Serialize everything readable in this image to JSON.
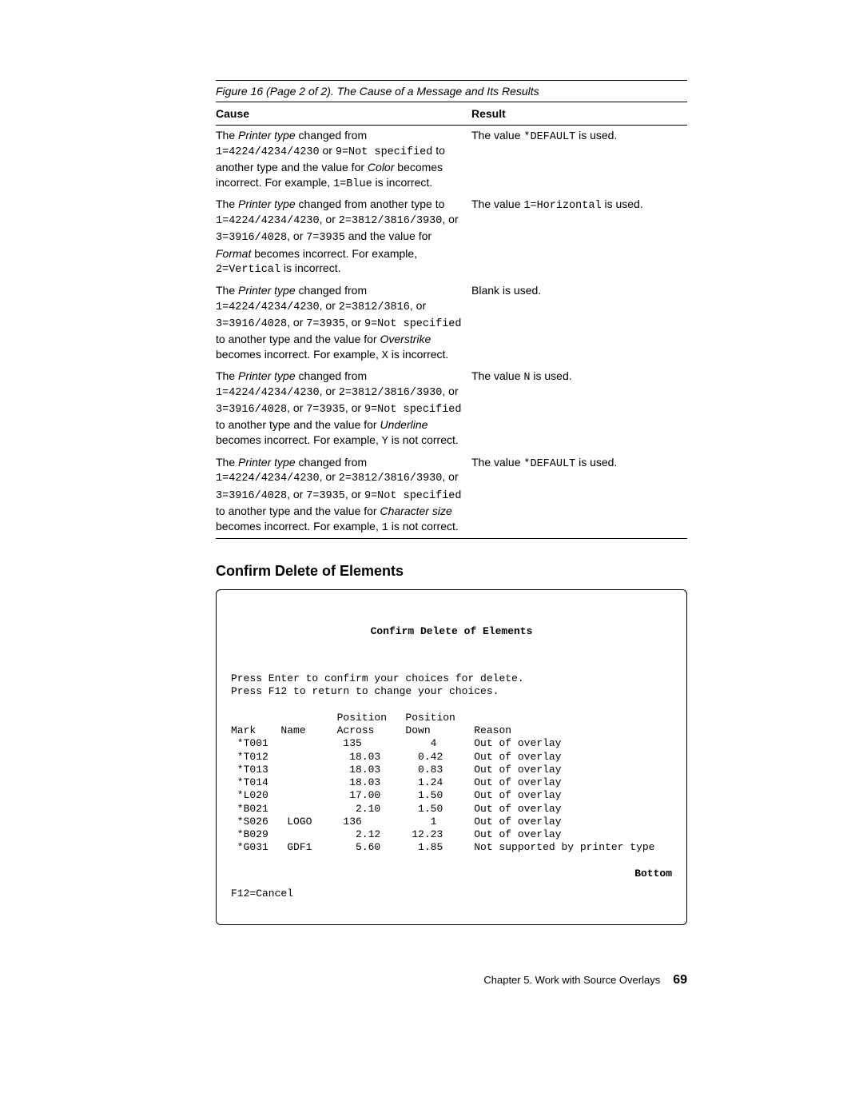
{
  "figure_caption": "Figure 16 (Page 2 of 2). The Cause of a Message and Its Results",
  "table": {
    "header_cause": "Cause",
    "header_result": "Result",
    "rows": [
      {
        "cause_pre1": "The ",
        "cause_it1": "Printer type",
        "cause_post1": " changed from ",
        "cause_mono1": "1=4224/4234/4230",
        "cause_post2": " or ",
        "cause_mono2": "9=Not specified",
        "cause_post3": " to another type and the value for ",
        "cause_it2": "Color",
        "cause_post4": " becomes incorrect.  For example, ",
        "cause_mono3": "1=Blue",
        "cause_post5": " is incorrect.",
        "result_pre": "The value ",
        "result_mono": "*DEFAULT",
        "result_post": " is used."
      },
      {
        "cause_pre1": "The ",
        "cause_it1": "Printer type",
        "cause_post1": " changed from another type to ",
        "cause_mono1": "1=4224/4234/4230",
        "cause_post2": ", or ",
        "cause_mono2": "2=3812/3816/3930",
        "cause_post3": ", or ",
        "cause_mono3": "3=3916/4028",
        "cause_post4": ", or ",
        "cause_mono4": "7=3935",
        "cause_post5": " and the value for ",
        "cause_it2": "Format",
        "cause_post6": " becomes incorrect.  For example, ",
        "cause_mono5": "2=Vertical",
        "cause_post7": " is incorrect.",
        "result_pre": "The value ",
        "result_mono": "1=Horizontal",
        "result_post": " is used."
      },
      {
        "cause_pre1": "The ",
        "cause_it1": "Printer type",
        "cause_post1": " changed from ",
        "cause_mono1": "1=4224/4234/4230",
        "cause_post2": ", or ",
        "cause_mono2": "2=3812/3816",
        "cause_post3": ", or ",
        "cause_mono3": "3=3916/4028",
        "cause_post4": ", or ",
        "cause_mono4": "7=3935",
        "cause_post5": ", or ",
        "cause_mono5": "9=Not specified",
        "cause_post6": " to another type and the value for ",
        "cause_it2": "Overstrike",
        "cause_post7": " becomes incorrect.  For example, ",
        "cause_mono6": "X",
        "cause_post8": " is incorrect.",
        "result_full": "Blank is used."
      },
      {
        "cause_pre1": "The ",
        "cause_it1": "Printer type",
        "cause_post1": " changed from ",
        "cause_mono1": "1=4224/4234/4230",
        "cause_post2": ", or ",
        "cause_mono2": "2=3812/3816/3930",
        "cause_post3": ", or ",
        "cause_mono3": "3=3916/4028",
        "cause_post4": ", or ",
        "cause_mono4": "7=3935",
        "cause_post5": ", or ",
        "cause_mono5": "9=Not specified",
        "cause_post6": " to another type and the value for ",
        "cause_it2": "Underline",
        "cause_post7": " becomes incorrect.  For example, ",
        "cause_mono6": "Y",
        "cause_post8": " is not correct.",
        "result_pre": "The value ",
        "result_mono": "N",
        "result_post": " is used."
      },
      {
        "cause_pre1": "The ",
        "cause_it1": "Printer type",
        "cause_post1": " changed from ",
        "cause_mono1": "1=4224/4234/4230",
        "cause_post2": ", or ",
        "cause_mono2": "2=3812/3816/3930",
        "cause_post3": ", or ",
        "cause_mono3": "3=3916/4028",
        "cause_post4": ", or ",
        "cause_mono4": "7=3935",
        "cause_post5": ", or ",
        "cause_mono5": "9=Not specified",
        "cause_post6": " to another type and the value for ",
        "cause_it2": "Character size",
        "cause_post7": " becomes incorrect.  For example, ",
        "cause_mono6": "1",
        "cause_post8": " is not correct.",
        "result_pre": "The value ",
        "result_mono": "*DEFAULT",
        "result_post": " is used."
      }
    ]
  },
  "section_title": "Confirm Delete of Elements",
  "terminal": {
    "title": "Confirm Delete of Elements",
    "instr1": "Press Enter to confirm your choices for delete.",
    "instr2": "Press F12 to return to change your choices.",
    "header_line1": "                 Position   Position",
    "header_line2": "Mark    Name     Across     Down       Reason",
    "rows": [
      " *T001            135           4      Out of overlay",
      " *T012             18.03      0.42     Out of overlay",
      " *T013             18.03      0.83     Out of overlay",
      " *T014             18.03      1.24     Out of overlay",
      " *L020             17.00      1.50     Out of overlay",
      " *B021              2.10      1.50     Out of overlay",
      " *S026   LOGO     136           1      Out of overlay",
      " *B029              2.12     12.23     Out of overlay",
      " *G031   GDF1       5.60      1.85     Not supported by printer type"
    ],
    "bottom": "Bottom",
    "cancel": "F12=Cancel"
  },
  "footer_text": "Chapter 5.  Work with Source Overlays",
  "page_number": "69"
}
